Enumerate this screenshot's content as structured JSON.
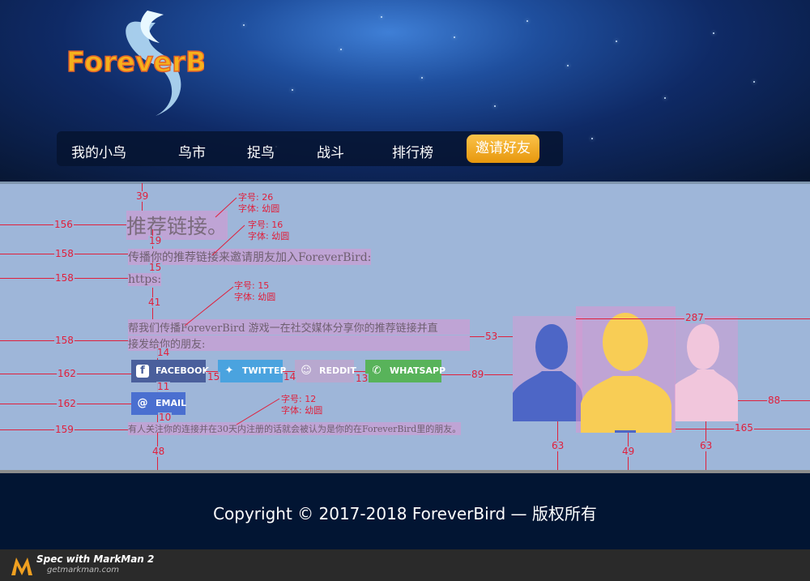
{
  "logo": {
    "text": "ForeverBird"
  },
  "nav": {
    "items": [
      "我的小鸟",
      "鸟市",
      "捉鸟",
      "战斗",
      "排行榜"
    ],
    "invite": "邀请好友"
  },
  "content": {
    "heading": "推荐链接。",
    "intro": "传播你的推荐链接来邀请朋友加入ForeverBird:",
    "link": "https:",
    "share_line1": "帮我们传播ForeverBird 游戏一在社交媒体分享你的推荐链接并直",
    "share_line2": "接发给你的朋友:",
    "notice": "有人关注你的连接并在30天内注册的话就会被认为是你的在ForeverBird里的朋友。"
  },
  "share_buttons": {
    "facebook": "FACEBOOK",
    "twitter": "TWITTER",
    "reddit": "REDDIT",
    "whatsapp": "WHATSAPP",
    "email": "EMAIL"
  },
  "colors": {
    "facebook": "#4a5f9c",
    "twitter": "#4aa3df",
    "reddit": "#b8a8cf",
    "whatsapp": "#58b35a",
    "email": "#4a6fd0",
    "accent": "#f2a81d",
    "measure": "#e0203c",
    "avatar_blue": "#4d66c6",
    "avatar_yellow": "#f8cd55",
    "avatar_pink": "#f1c6dc"
  },
  "annotations": {
    "font_notes": [
      {
        "size": "字号: 26",
        "font": "字体: 幼圆"
      },
      {
        "size": "字号: 16",
        "font": "字体: 幼圆"
      },
      {
        "size": "字号: 15",
        "font": "字体: 幼圆"
      },
      {
        "size": "字号: 12",
        "font": "字体: 幼圆"
      }
    ],
    "numbers": [
      "39",
      "156",
      "19",
      "158",
      "15",
      "158",
      "41",
      "158",
      "14",
      "162",
      "15",
      "14",
      "13",
      "89",
      "11",
      "162",
      "10",
      "159",
      "48",
      "53",
      "287",
      "88",
      "165",
      "63",
      "49",
      "63"
    ]
  },
  "footer": {
    "copyright": "Copyright © 2017-2018 ForeverBird — 版权所有"
  },
  "branding": {
    "title": "Spec with MarkMan 2",
    "site": "getmarkman.com"
  }
}
